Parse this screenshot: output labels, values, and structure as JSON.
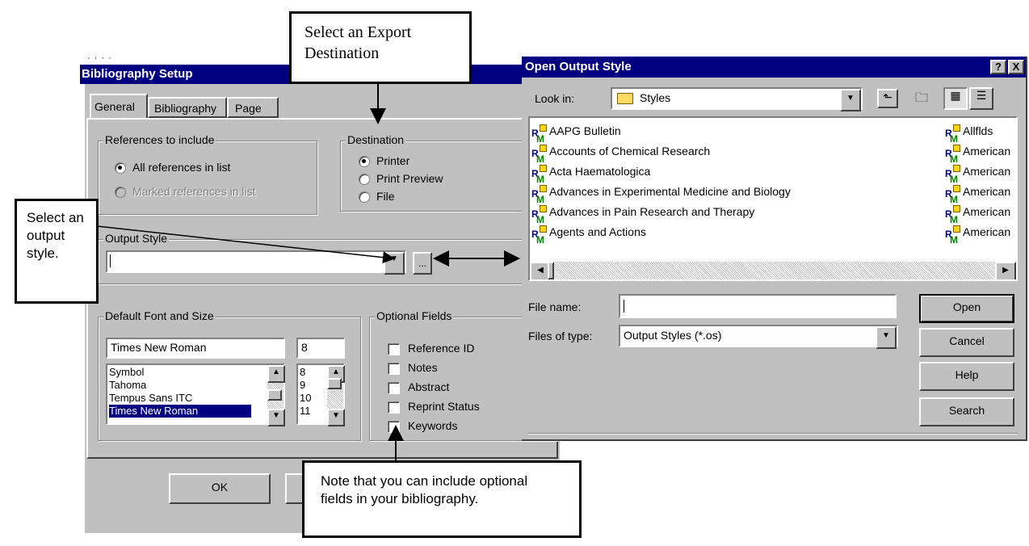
{
  "callouts": {
    "export": "Select an Export Destination",
    "output_style": "Select an output style.",
    "optional": "Note that you can include optional fields in your bibliography."
  },
  "bib": {
    "top_dots": "· · · ·",
    "title": "Bibliography Setup",
    "tabs": [
      "General",
      "Bibliography",
      "Page"
    ],
    "refs_group": "References to include",
    "refs_all": "All references in list",
    "refs_marked": "Marked references in list",
    "dest_group": "Destination",
    "dest_printer": "Printer",
    "dest_preview": "Print Preview",
    "dest_file": "File",
    "output_group": "Output Style",
    "output_value": "",
    "browse": "...",
    "font_group": "Default Font and Size",
    "font_value": "Times New Roman",
    "size_value": "8",
    "fonts": [
      "Symbol",
      "Tahoma",
      "Tempus Sans ITC",
      "Times New Roman"
    ],
    "sizes": [
      "8",
      "9",
      "10",
      "11"
    ],
    "optional_group": "Optional Fields",
    "fields": [
      "Reference ID",
      "Notes",
      "Abstract",
      "Reprint Status",
      "Keywords"
    ],
    "ok": "OK"
  },
  "open": {
    "title": "Open Output Style",
    "help_btn": "?",
    "close_btn": "X",
    "look_in_label": "Look in:",
    "look_in_value": "Styles",
    "files_left": [
      "AAPG Bulletin",
      "Accounts of Chemical Research",
      "Acta Haematologica",
      "Advances in Experimental Medicine and Biology",
      "Advances in Pain Research and Therapy",
      "Agents and Actions"
    ],
    "files_right": [
      "Allflds",
      "American",
      "American",
      "American",
      "American",
      "American"
    ],
    "file_name_label": "File name:",
    "file_name_value": "",
    "files_type_label": "Files of type:",
    "files_type_value": "Output Styles (*.os)",
    "open": "Open",
    "cancel": "Cancel",
    "help": "Help",
    "search": "Search"
  }
}
